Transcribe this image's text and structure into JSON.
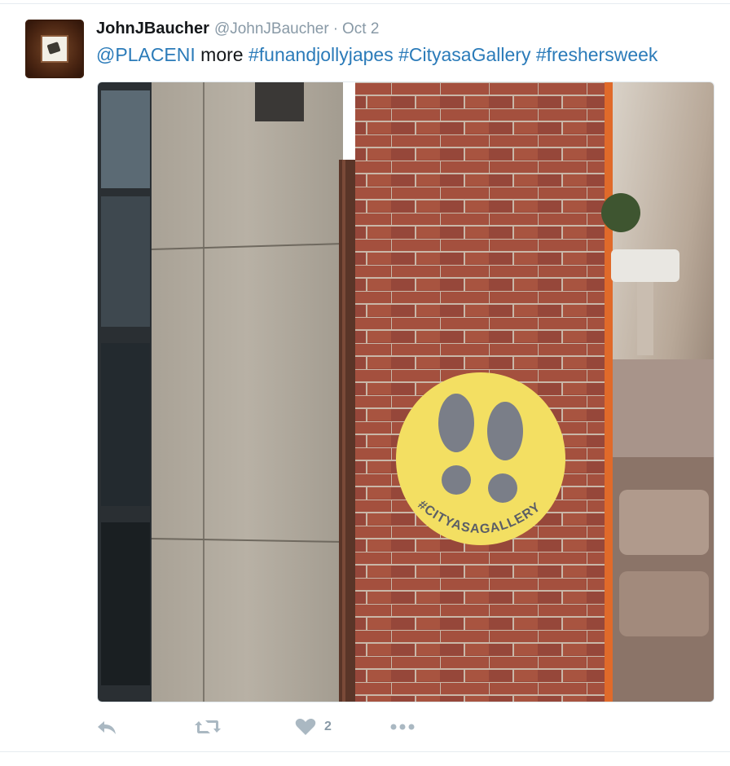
{
  "tweet": {
    "name": "JohnJBaucher",
    "handle": "@JohnJBaucher",
    "separator": "·",
    "date": "Oct 2",
    "text": {
      "mention": "@PLACENI",
      "word": "more",
      "hashtags": [
        "#funandjollyjapes",
        "#CityasaGallery",
        "#freshersweek"
      ]
    },
    "photo": {
      "sticker_text": "#CITYASAGALLERY"
    },
    "actions": {
      "reply": "reply-icon",
      "retweet": "retweet-icon",
      "like": "heart-icon",
      "like_count": "2",
      "more": "more-icon"
    }
  },
  "colors": {
    "link": "#2b7bb9",
    "name": "#14171a",
    "muted": "#8899a6",
    "icon": "#aab8c2",
    "sticker": "#f3df62",
    "brick": "#9b4a3a"
  }
}
